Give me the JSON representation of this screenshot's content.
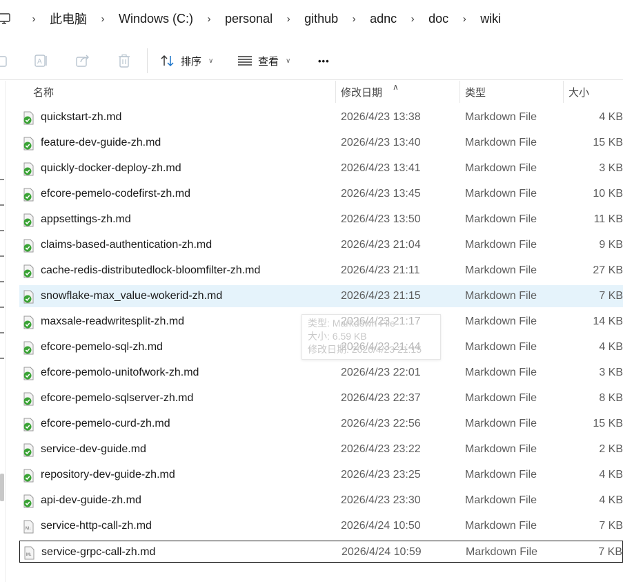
{
  "breadcrumb": {
    "items": [
      "此电脑",
      "Windows  (C:)",
      "personal",
      "github",
      "adnc",
      "doc",
      "wiki"
    ]
  },
  "toolbar": {
    "sort_label": "排序",
    "view_label": "查看",
    "more_label": "•••"
  },
  "columns": {
    "name": "名称",
    "date": "修改日期",
    "type": "类型",
    "size": "大小"
  },
  "files": [
    {
      "name": "quickstart-zh.md",
      "date": "2026/4/23 13:38",
      "type": "Markdown File",
      "size": "4 KB",
      "synced": true
    },
    {
      "name": "feature-dev-guide-zh.md",
      "date": "2026/4/23 13:40",
      "type": "Markdown File",
      "size": "15 KB",
      "synced": true
    },
    {
      "name": "quickly-docker-deploy-zh.md",
      "date": "2026/4/23 13:41",
      "type": "Markdown File",
      "size": "3 KB",
      "synced": true
    },
    {
      "name": "efcore-pemelo-codefirst-zh.md",
      "date": "2026/4/23 13:45",
      "type": "Markdown File",
      "size": "10 KB",
      "synced": true
    },
    {
      "name": "appsettings-zh.md",
      "date": "2026/4/23 13:50",
      "type": "Markdown File",
      "size": "11 KB",
      "synced": true
    },
    {
      "name": "claims-based-authentication-zh.md",
      "date": "2026/4/23 21:04",
      "type": "Markdown File",
      "size": "9 KB",
      "synced": true
    },
    {
      "name": "cache-redis-distributedlock-bloomfilter-zh.md",
      "date": "2026/4/23 21:11",
      "type": "Markdown File",
      "size": "27 KB",
      "synced": true
    },
    {
      "name": "snowflake-max_value-wokerid-zh.md",
      "date": "2026/4/23 21:15",
      "type": "Markdown File",
      "size": "7 KB",
      "synced": true
    },
    {
      "name": "maxsale-readwritesplit-zh.md",
      "date": "2026/4/23 21:17",
      "type": "Markdown File",
      "size": "14 KB",
      "synced": true
    },
    {
      "name": "efcore-pemelo-sql-zh.md",
      "date": "2026/4/23 21:44",
      "type": "Markdown File",
      "size": "4 KB",
      "synced": true
    },
    {
      "name": "efcore-pemolo-unitofwork-zh.md",
      "date": "2026/4/23 22:01",
      "type": "Markdown File",
      "size": "3 KB",
      "synced": true
    },
    {
      "name": "efcore-pemelo-sqlserver-zh.md",
      "date": "2026/4/23 22:37",
      "type": "Markdown File",
      "size": "8 KB",
      "synced": true
    },
    {
      "name": "efcore-pemelo-curd-zh.md",
      "date": "2026/4/23 22:56",
      "type": "Markdown File",
      "size": "15 KB",
      "synced": true
    },
    {
      "name": "service-dev-guide.md",
      "date": "2026/4/23 23:22",
      "type": "Markdown File",
      "size": "2 KB",
      "synced": true
    },
    {
      "name": "repository-dev-guide-zh.md",
      "date": "2026/4/23 23:25",
      "type": "Markdown File",
      "size": "4 KB",
      "synced": true
    },
    {
      "name": "api-dev-guide-zh.md",
      "date": "2026/4/23 23:30",
      "type": "Markdown File",
      "size": "4 KB",
      "synced": true
    },
    {
      "name": "service-http-call-zh.md",
      "date": "2026/4/24 10:50",
      "type": "Markdown File",
      "size": "7 KB",
      "synced": false
    },
    {
      "name": "service-grpc-call-zh.md",
      "date": "2026/4/24 10:59",
      "type": "Markdown File",
      "size": "7 KB",
      "synced": false
    }
  ],
  "tooltip": {
    "line1": "类型: Markdown File",
    "line2": "大小: 6.59 KB",
    "line3": "修改日期: 2026/4/23 21:15"
  },
  "colors": {
    "hover_row": "#e5f3fb",
    "sync_green": "#3aa335"
  }
}
